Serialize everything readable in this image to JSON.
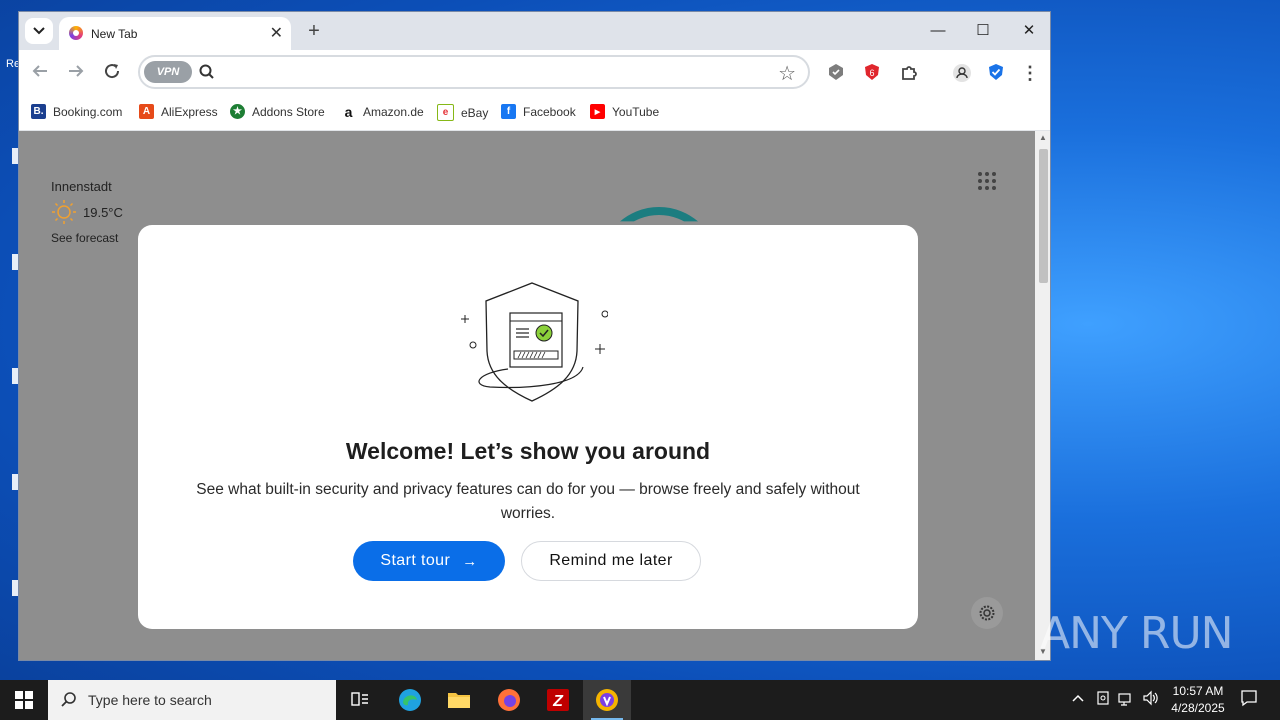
{
  "browser": {
    "tab_title": "New Tab",
    "tab_close": "✕",
    "new_tab": "+",
    "window_buttons": {
      "minimize": "—",
      "maximize": "☐",
      "close": "✕"
    },
    "vpn_badge": "VPN",
    "omnibox_placeholder": ""
  },
  "bookmarks": [
    {
      "label": "Booking.com",
      "icon": "booking-icon",
      "color": "#1b3f8f",
      "glyph": "B."
    },
    {
      "label": "AliExpress",
      "icon": "aliexpress-icon",
      "color": "#e64a19",
      "glyph": "A"
    },
    {
      "label": "Addons Store",
      "icon": "addons-icon",
      "color": "#1e7e34",
      "glyph": "★"
    },
    {
      "label": "Amazon.de",
      "icon": "amazon-icon",
      "color": "#ffffff",
      "glyph": "a"
    },
    {
      "label": "eBay",
      "icon": "ebay-icon",
      "color": "#ffffff",
      "glyph": "e"
    },
    {
      "label": "Facebook",
      "icon": "facebook-icon",
      "color": "#1877f2",
      "glyph": "f"
    },
    {
      "label": "YouTube",
      "icon": "youtube-icon",
      "color": "#ff0000",
      "glyph": "▶"
    }
  ],
  "newtab": {
    "weather_city": "Innenstadt",
    "weather_temp": "19.5°C",
    "forecast_link": "See forecast"
  },
  "modal": {
    "title": "Welcome! Let’s show you around",
    "description": "See what built-in security and privacy features can do for you — browse freely and safely without worries.",
    "primary_button": "Start tour",
    "primary_arrow": "→",
    "secondary_button": "Remind me later"
  },
  "taskbar": {
    "search_placeholder": "Type here to search",
    "time": "10:57 AM",
    "date": "4/28/2025"
  },
  "watermark": "ANY RUN",
  "colors": {
    "accent": "#0a6ee8",
    "overlay_page": "#8e8e8e",
    "taskbar": "#1c1c1c"
  }
}
